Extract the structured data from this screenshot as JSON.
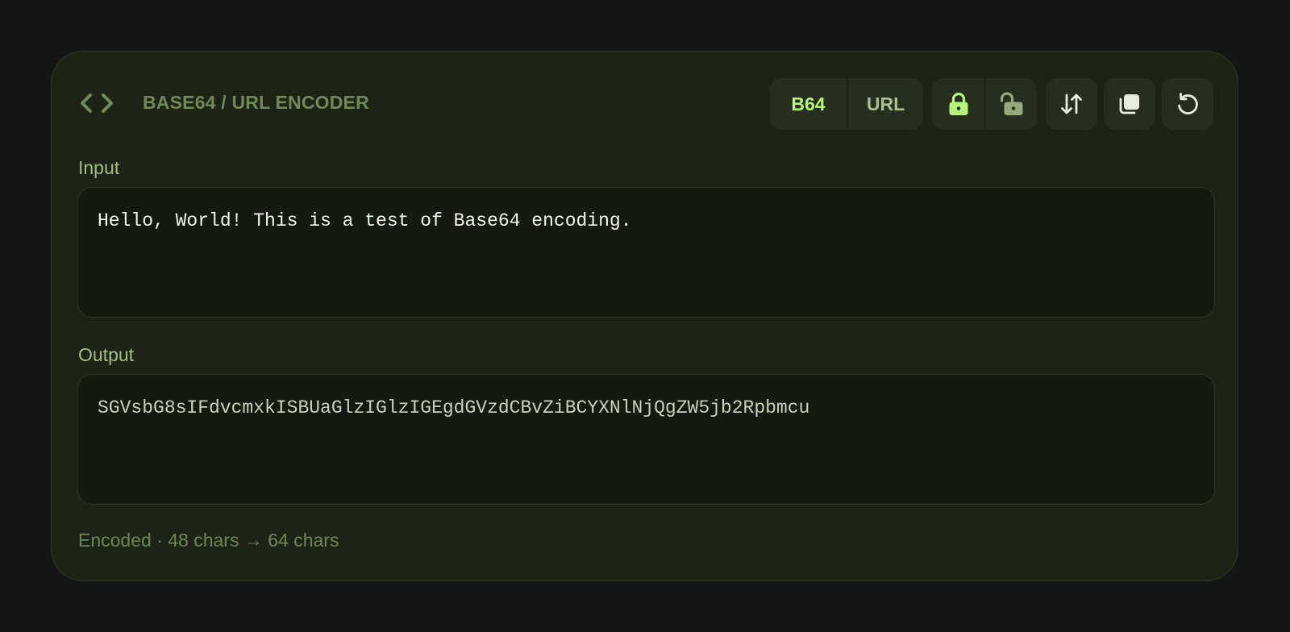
{
  "header": {
    "title": "BASE64 / URL ENCODER",
    "logo_icon": "code-brackets-icon"
  },
  "toolbar": {
    "mode_options": [
      {
        "label": "B64",
        "active": true
      },
      {
        "label": "URL",
        "active": false
      }
    ],
    "direction": {
      "encode_icon": "lock-icon",
      "decode_icon": "unlock-icon",
      "active": "encode"
    },
    "swap_icon": "swap-arrows-icon",
    "copy_icon": "copy-icon",
    "reset_icon": "reset-icon"
  },
  "input": {
    "label": "Input",
    "value": "Hello, World! This is a test of Base64 encoding."
  },
  "output": {
    "label": "Output",
    "value": "SGVsbG8sIFdvcmxkISBUaGlzIGlzIGEgdGVzdCBvZiBCYXNlNjQgZW5jb2Rpbmcu"
  },
  "status": {
    "text": "Encoded · 48 chars → 64 chars"
  },
  "colors": {
    "background": "#151515",
    "card": "#1d2415",
    "accent": "#b6f37c",
    "muted": "#6f8a57"
  }
}
